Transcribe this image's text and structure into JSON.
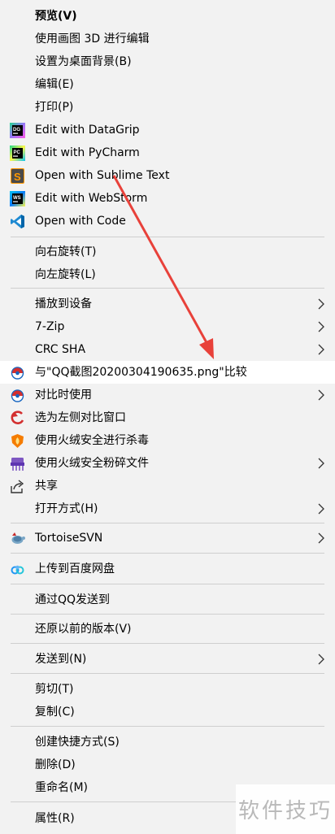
{
  "menu": {
    "items": [
      {
        "label": "预览(V)"
      },
      {
        "label": "使用画图 3D 进行编辑"
      },
      {
        "label": "设置为桌面背景(B)"
      },
      {
        "label": "编辑(E)"
      },
      {
        "label": "打印(P)"
      },
      {
        "label": "Edit with DataGrip"
      },
      {
        "label": "Edit with PyCharm"
      },
      {
        "label": "Open with Sublime Text"
      },
      {
        "label": "Edit with WebStorm"
      },
      {
        "label": "Open with Code"
      },
      {
        "label": "向右旋转(T)"
      },
      {
        "label": "向左旋转(L)"
      },
      {
        "label": "播放到设备"
      },
      {
        "label": "7-Zip"
      },
      {
        "label": "CRC SHA"
      },
      {
        "label": "与\"QQ截图20200304190635.png\"比较"
      },
      {
        "label": "对比时使用"
      },
      {
        "label": "选为左侧对比窗口"
      },
      {
        "label": "使用火绒安全进行杀毒"
      },
      {
        "label": "使用火绒安全粉碎文件"
      },
      {
        "label": "共享"
      },
      {
        "label": "打开方式(H)"
      },
      {
        "label": "TortoiseSVN"
      },
      {
        "label": "上传到百度网盘"
      },
      {
        "label": "通过QQ发送到"
      },
      {
        "label": "还原以前的版本(V)"
      },
      {
        "label": "发送到(N)"
      },
      {
        "label": "剪切(T)"
      },
      {
        "label": "复制(C)"
      },
      {
        "label": "创建快捷方式(S)"
      },
      {
        "label": "删除(D)"
      },
      {
        "label": "重命名(M)"
      },
      {
        "label": "属性(R)"
      }
    ]
  },
  "icons": {
    "datagrip": "DG",
    "pycharm": "PC",
    "webstorm": "WS",
    "sublime": "S"
  },
  "watermark": "软件技巧",
  "colors": {
    "menu_bg": "#f2f2f2",
    "highlight_bg": "#ffffff",
    "separator": "#cfcfcf",
    "annotation_arrow": "#e8413a"
  }
}
